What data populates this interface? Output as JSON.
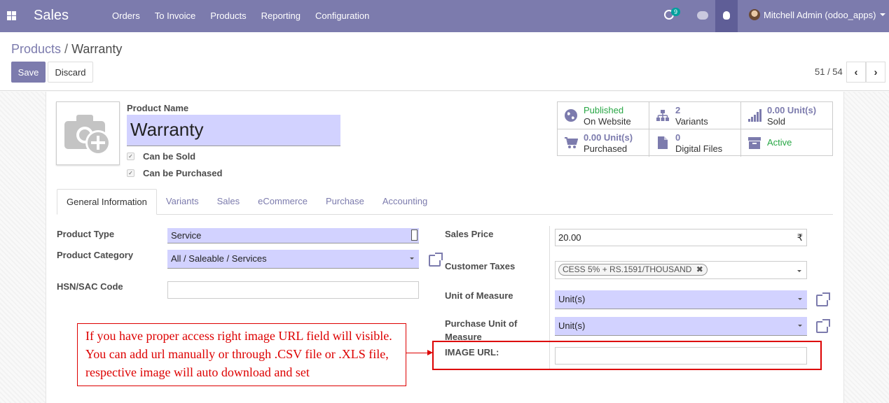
{
  "navbar": {
    "brand": "Sales",
    "menu": [
      "Orders",
      "To Invoice",
      "Products",
      "Reporting",
      "Configuration"
    ],
    "activity_count": "9",
    "user": "Mitchell Admin (odoo_apps)"
  },
  "breadcrumb": {
    "parent": "Products",
    "separator": "/",
    "current": "Warranty"
  },
  "toolbar": {
    "save_label": "Save",
    "discard_label": "Discard",
    "pager": "51 / 54"
  },
  "product": {
    "name_label": "Product Name",
    "name": "Warranty",
    "can_be_sold": "Can be Sold",
    "can_be_purchased": "Can be Purchased"
  },
  "stats": [
    {
      "value": "Published",
      "label": "On Website",
      "icon": "globe-icon"
    },
    {
      "value": "2",
      "label": "Variants",
      "icon": "sitemap-icon"
    },
    {
      "value": "0.00 Unit(s)",
      "label": "Sold",
      "icon": "signal-icon"
    },
    {
      "value": "0.00 Unit(s)",
      "label": "Purchased",
      "icon": "cart-icon"
    },
    {
      "value": "0",
      "label": "Digital Files",
      "icon": "file-icon"
    },
    {
      "value": "Active",
      "label": "",
      "icon": "archive-icon"
    }
  ],
  "tabs": [
    "General Information",
    "Variants",
    "Sales",
    "eCommerce",
    "Purchase",
    "Accounting"
  ],
  "left_fields": {
    "product_type_label": "Product Type",
    "product_type": "Service",
    "product_category_label": "Product Category",
    "product_category": "All / Saleable / Services",
    "hsn_label": "HSN/SAC Code",
    "hsn": ""
  },
  "right_fields": {
    "sales_price_label": "Sales Price",
    "sales_price": "20.00",
    "currency": "₹",
    "customer_taxes_label": "Customer Taxes",
    "customer_tax_tag": "CESS 5% + RS.1591/THOUSAND",
    "uom_label": "Unit of Measure",
    "uom": "Unit(s)",
    "purchase_uom_label_1": "Purchase Unit of",
    "purchase_uom_label_2": "Measure",
    "purchase_uom": "Unit(s)",
    "image_url_label": "IMAGE URL:",
    "image_url": ""
  },
  "annotation": {
    "line1": "If you have proper access right image URL field will visible.",
    "line2": "You can add url manually or through .CSV file or .XLS file,",
    "line3": "respective image will auto download and set",
    "color": "#dd0000"
  },
  "colors": {
    "primary": "#7c7bad",
    "editable": "#d2d2ff",
    "success": "#28a745"
  }
}
